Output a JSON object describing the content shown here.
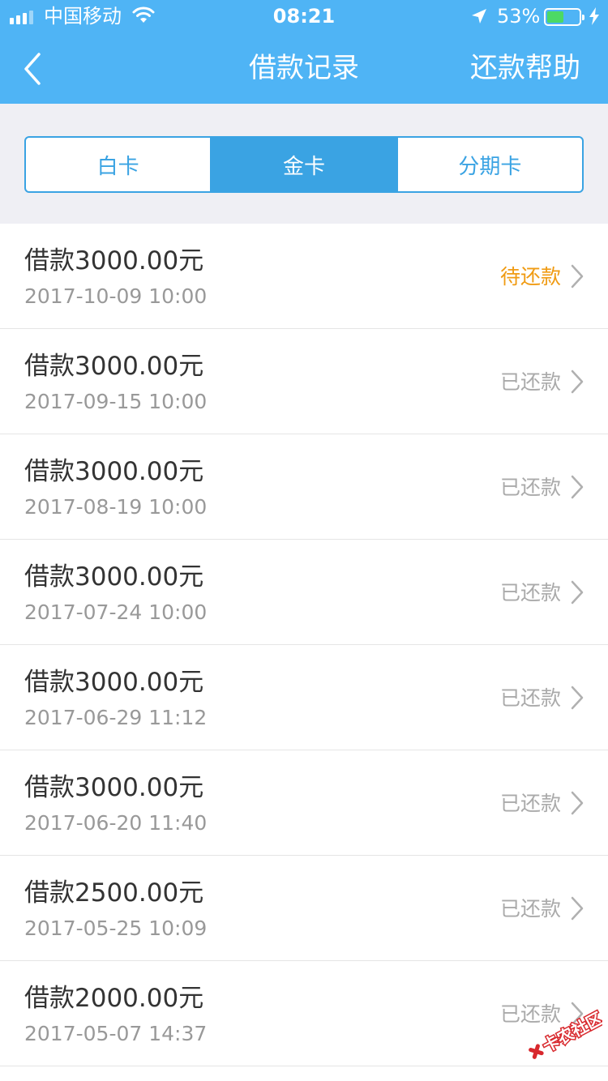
{
  "status_bar": {
    "carrier": "中国移动",
    "time": "08:21",
    "battery": "53%",
    "battery_level": 0.53,
    "icons": [
      "signal-icon",
      "wifi-icon",
      "location-icon",
      "battery-icon",
      "charging-icon"
    ]
  },
  "nav": {
    "back_icon": "chevron-left-icon",
    "title": "借款记录",
    "help": "还款帮助"
  },
  "tabs": [
    {
      "label": "白卡",
      "active": false
    },
    {
      "label": "金卡",
      "active": true
    },
    {
      "label": "分期卡",
      "active": false
    }
  ],
  "records": [
    {
      "amount": "借款3000.00元",
      "date": "2017-10-09 10:00",
      "status": "待还款",
      "pending": true
    },
    {
      "amount": "借款3000.00元",
      "date": "2017-09-15 10:00",
      "status": "已还款",
      "pending": false
    },
    {
      "amount": "借款3000.00元",
      "date": "2017-08-19 10:00",
      "status": "已还款",
      "pending": false
    },
    {
      "amount": "借款3000.00元",
      "date": "2017-07-24 10:00",
      "status": "已还款",
      "pending": false
    },
    {
      "amount": "借款3000.00元",
      "date": "2017-06-29 11:12",
      "status": "已还款",
      "pending": false
    },
    {
      "amount": "借款3000.00元",
      "date": "2017-06-20 11:40",
      "status": "已还款",
      "pending": false
    },
    {
      "amount": "借款2500.00元",
      "date": "2017-05-25 10:09",
      "status": "已还款",
      "pending": false
    },
    {
      "amount": "借款2000.00元",
      "date": "2017-05-07 14:37",
      "status": "已还款",
      "pending": false
    }
  ],
  "watermark": "卡农社区",
  "colors": {
    "header": "#4fb4f5",
    "accent": "#3aa3e3",
    "pending": "#f09b13",
    "muted": "#aaaaaa"
  }
}
